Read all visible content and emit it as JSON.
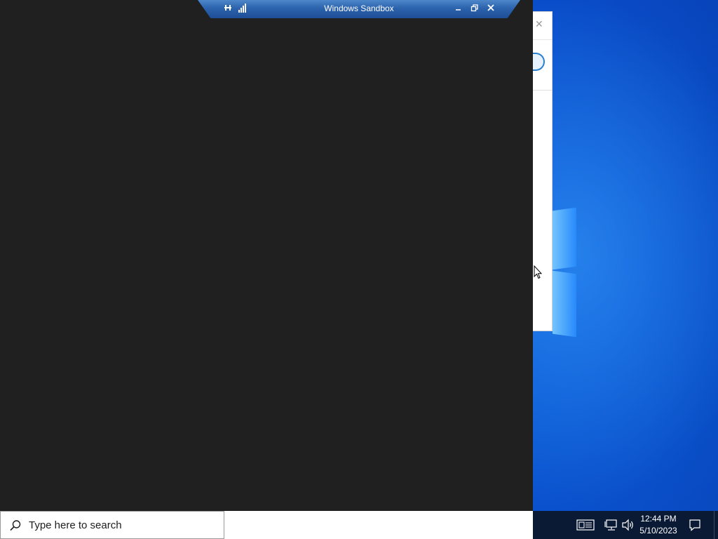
{
  "sandbox_window": {
    "title": "Windows Sandbox",
    "icons": [
      "pin-icon",
      "connection-signal-icon",
      "minimize-icon",
      "restore-icon",
      "close-icon"
    ]
  },
  "background_window": {
    "icons": [
      "close-icon",
      "app-icon"
    ]
  },
  "taskbar": {
    "search_placeholder": "Type here to search",
    "tray_icons": [
      "news-and-interests-icon",
      "network-icon",
      "volume-icon",
      "notification-center-icon"
    ],
    "time": "12:44 PM",
    "date": "5/10/2023"
  },
  "colors": {
    "desktop_blue": "#0a4cd0",
    "sandbox_background": "#202020",
    "connection_bar": "#2c63ad",
    "taskbar": "#0b1a34"
  }
}
